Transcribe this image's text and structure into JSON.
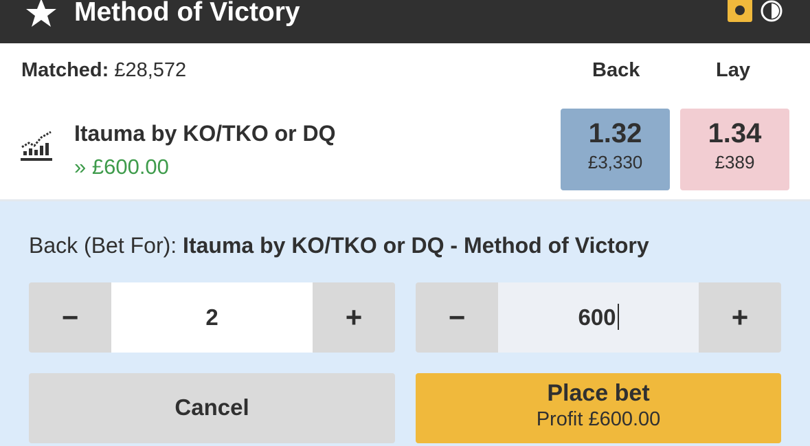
{
  "header": {
    "title": "Method of Victory",
    "icons": [
      "star-icon",
      "rules-icon",
      "clock-icon"
    ]
  },
  "market": {
    "matched_label": "Matched:",
    "matched_value": "£28,572",
    "back_header": "Back",
    "lay_header": "Lay"
  },
  "runner": {
    "name": "Itauma by KO/TKO or DQ",
    "profit_loss": "» £600.00",
    "back": {
      "odds": "1.32",
      "size": "£3,330"
    },
    "lay": {
      "odds": "1.34",
      "size": "£389"
    }
  },
  "betslip": {
    "side_label": "Back (Bet For):",
    "selection": "Itauma by KO/TKO or DQ - Method of Victory",
    "odds_value": "2",
    "stake_value": "600",
    "minus_label": "−",
    "plus_label": "+",
    "cancel_label": "Cancel",
    "place_label": "Place bet",
    "profit_text": "Profit £600.00"
  },
  "colors": {
    "header_bg": "#303030",
    "accent_yellow": "#f0b93c",
    "back_blue": "#8daccb",
    "lay_pink": "#f2cdd2",
    "slip_bg": "#dcebfa",
    "profit_green": "#3e9b4b"
  }
}
